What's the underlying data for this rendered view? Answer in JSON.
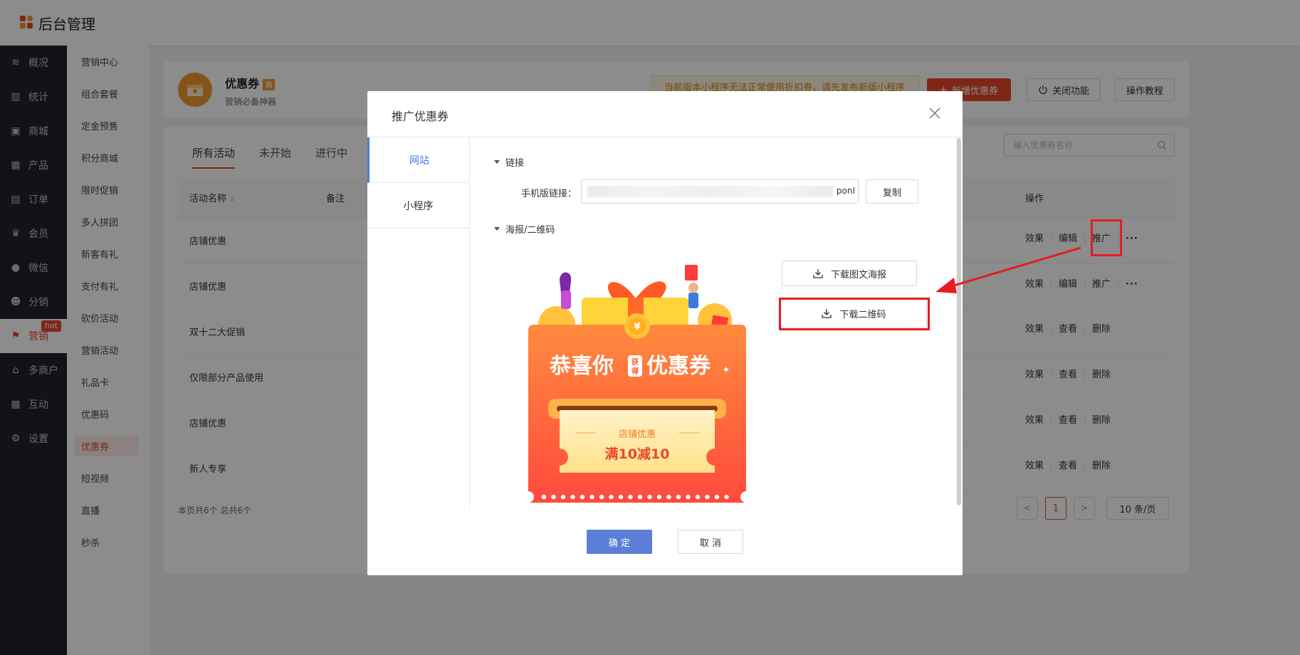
{
  "app": {
    "title": "后台管理"
  },
  "sidebar": {
    "items": [
      {
        "label": "概况",
        "icon": "layers-icon"
      },
      {
        "label": "统计",
        "icon": "chart-icon"
      },
      {
        "label": "商城",
        "icon": "shop-icon"
      },
      {
        "label": "产品",
        "icon": "grid-icon"
      },
      {
        "label": "订单",
        "icon": "order-icon"
      },
      {
        "label": "会员",
        "icon": "crown-icon"
      },
      {
        "label": "微信",
        "icon": "wechat-icon"
      },
      {
        "label": "分销",
        "icon": "user-icon"
      },
      {
        "label": "营销",
        "icon": "flag-icon",
        "active": true,
        "badge": "hot"
      },
      {
        "label": "多商户",
        "icon": "store-icon"
      },
      {
        "label": "互动",
        "icon": "apps-icon"
      },
      {
        "label": "设置",
        "icon": "gear-icon"
      }
    ]
  },
  "subsidebar": {
    "items": [
      "营销中心",
      "组合套餐",
      "定金预售",
      "积分商城",
      "限时促销",
      "多人拼团",
      "新客有礼",
      "支付有礼",
      "砍价活动",
      "营销活动",
      "礼品卡",
      "优惠码",
      "优惠券",
      "短视频",
      "直播",
      "秒杀"
    ],
    "active": "优惠券"
  },
  "header": {
    "title": "优惠券",
    "badge": "高",
    "subtitle": "营销必备神器",
    "notice": "当前版本小程序无法正常使用折扣券，请先发布新版小程序",
    "add_button": "新增优惠券",
    "close_button": "关闭功能",
    "tutorial_button": "操作教程"
  },
  "list": {
    "tabs": [
      "所有活动",
      "未开始",
      "进行中"
    ],
    "search_placeholder": "输入优惠券名称",
    "columns": {
      "name": "活动名称",
      "remark": "备注",
      "ops": "操作"
    },
    "rows": [
      {
        "name": "店铺优惠",
        "ops": [
          "效果",
          "编辑",
          "推广"
        ],
        "more": "···"
      },
      {
        "name": "店铺优惠",
        "ops": [
          "效果",
          "编辑",
          "推广"
        ],
        "more": "···"
      },
      {
        "name": "双十二大促销",
        "ops": [
          "效果",
          "查看",
          "删除"
        ]
      },
      {
        "name": "仅限部分产品使用",
        "ops": [
          "效果",
          "查看",
          "删除"
        ]
      },
      {
        "name": "店铺优惠",
        "ops": [
          "效果",
          "查看",
          "删除"
        ]
      },
      {
        "name": "新人专享",
        "ops": [
          "效果",
          "查看",
          "删除"
        ]
      }
    ],
    "footer": "本页共6个 总共6个",
    "pagination": {
      "prev": "<",
      "page": "1",
      "next": ">",
      "page_size": "10 条/页"
    }
  },
  "modal": {
    "title": "推广优惠券",
    "tabs": [
      "网站",
      "小程序"
    ],
    "active_tab": "网站",
    "link_section": "链接",
    "link_label": "手机版链接：",
    "link_value_tail": "ponI",
    "copy_button": "复制",
    "poster_section": "海报/二维码",
    "download_poster": "下载图文海报",
    "download_qr": "下载二维码",
    "poster": {
      "headline_a": "恭喜你",
      "headline_tag": "获得",
      "headline_b": "优惠券",
      "coupon_name": "店铺优惠",
      "coupon_rule": "满10减10"
    },
    "ok_button": "确 定",
    "cancel_button": "取 消"
  },
  "colors": {
    "accent": "#e8472b",
    "primary": "#5b7fd6",
    "tab_active": "#4b7bec",
    "highlight": "#e51c23"
  }
}
